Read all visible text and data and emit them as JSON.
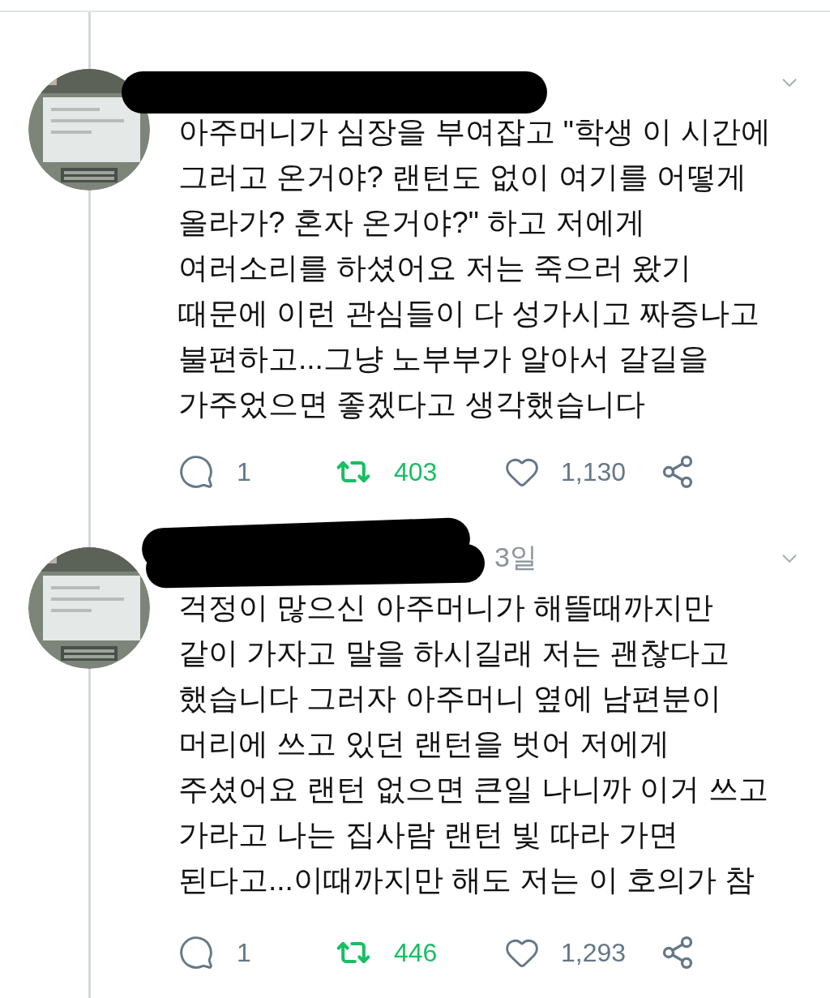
{
  "tweets": [
    {
      "lines": [
        "아주머니가 심장을 부여잡고 \"학생 이 시간에",
        "그러고 온거야? 랜턴도 없이 여기를 어떻게",
        "올라가? 혼자 온거야?\" 하고 저에게",
        "여러소리를 하셨어요 저는 죽으러 왔기",
        "때문에 이런 관심들이 다 성가시고 짜증나고",
        "불편하고...그냥 노부부가 알아서 갈길을",
        "가주었으면 좋겠다고 생각했습니다"
      ],
      "replies": "1",
      "retweets": "403",
      "retweeted": true,
      "likes": "1,130",
      "liked": false
    },
    {
      "date": "3일",
      "lines": [
        "걱정이 많으신 아주머니가 해뜰때까지만",
        "같이 가자고 말을 하시길래 저는 괜찮다고",
        "했습니다 그러자 아주머니 옆에 남편분이",
        "머리에 쓰고 있던 랜턴을 벗어 저에게",
        "주셨어요 랜턴 없으면 큰일 나니까 이거 쓰고",
        "가라고 나는 집사람 랜턴 빛 따라 가면",
        "된다고...이때까지만 해도 저는 이 호의가 참"
      ],
      "replies": "1",
      "retweets": "446",
      "retweeted": true,
      "likes": "1,293",
      "liked": false
    }
  ]
}
